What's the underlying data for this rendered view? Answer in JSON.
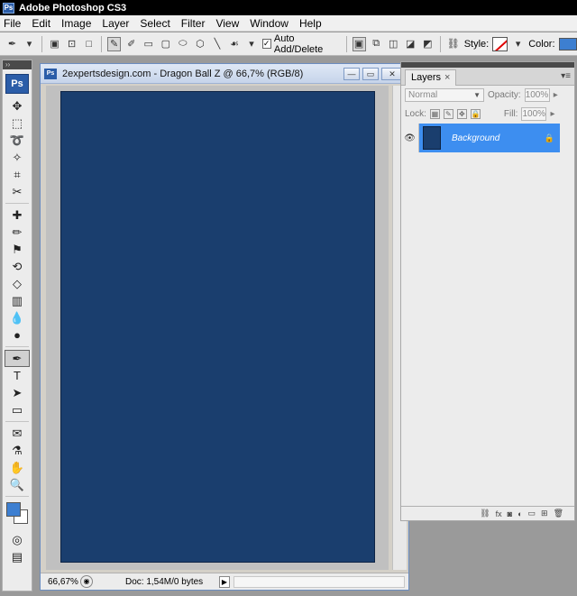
{
  "window": {
    "title": "Adobe Photoshop CS3",
    "app_icon": "Ps"
  },
  "menu": [
    "File",
    "Edit",
    "Image",
    "Layer",
    "Select",
    "Filter",
    "View",
    "Window",
    "Help"
  ],
  "options_bar": {
    "auto_add_delete_label": "Auto Add/Delete",
    "style_label": "Style:",
    "color_label": "Color:",
    "color_value": "#3d7fd1"
  },
  "toolbox": {
    "logo": "Ps",
    "foreground_color": "#3d7fd1",
    "background_color": "#ffffff"
  },
  "document": {
    "title": "2expertsdesign.com - Dragon Ball Z @ 66,7% (RGB/8)",
    "canvas_color": "#1a3e6e",
    "zoom": "66,67%",
    "doc_info": "Doc: 1,54M/0 bytes"
  },
  "layers_panel": {
    "tab_label": "Layers",
    "blend_mode": "Normal",
    "opacity_label": "Opacity:",
    "opacity_value": "100%",
    "lock_label": "Lock:",
    "fill_label": "Fill:",
    "fill_value": "100%",
    "layers": [
      {
        "name": "Background",
        "selected": true,
        "visible": true,
        "locked": true
      }
    ]
  }
}
